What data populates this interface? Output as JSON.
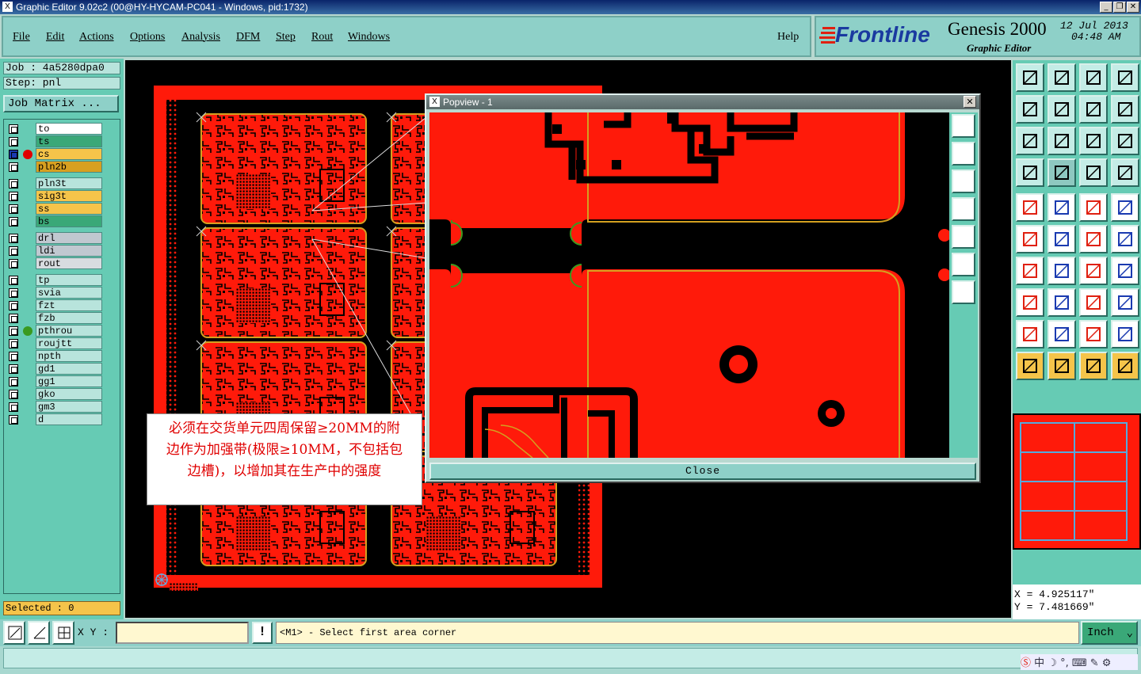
{
  "window": {
    "title": "Graphic Editor 9.02c2 (00@HY-HYCAM-PC041 - Windows, pid:1732)",
    "buttons": [
      "_",
      "❐",
      "✕"
    ]
  },
  "menu": {
    "items": [
      "File",
      "Edit",
      "Actions",
      "Options",
      "Analysis",
      "DFM",
      "Step",
      "Rout",
      "Windows"
    ],
    "help": "Help"
  },
  "brand": {
    "logo": "Frontline",
    "product": "Genesis 2000",
    "subtitle": "Graphic Editor",
    "date": "12 Jul 2013",
    "time": "04:48 AM"
  },
  "job": {
    "job_label": "Job : 4a5280dpa0",
    "step_label": "Step: pnl",
    "matrix_button": "Job Matrix ..."
  },
  "layers": [
    {
      "name": "to",
      "color": "#ffffff",
      "dot": ""
    },
    {
      "name": "ts",
      "color": "#3aa878",
      "dot": ""
    },
    {
      "name": "cs",
      "color": "#f5c44a",
      "dot": "#e00000",
      "active": true
    },
    {
      "name": "pln2b",
      "color": "#d8a020",
      "dot": ""
    },
    {
      "name": "pln3t",
      "color": "#b8e4dc",
      "dot": ""
    },
    {
      "name": "sig3t",
      "color": "#f5c44a",
      "dot": ""
    },
    {
      "name": "ss",
      "color": "#f5c44a",
      "dot": ""
    },
    {
      "name": "bs",
      "color": "#3aa878",
      "dot": ""
    },
    {
      "name": "drl",
      "color": "#c0c8d0",
      "dot": ""
    },
    {
      "name": "ldi",
      "color": "#c0c8d0",
      "dot": ""
    },
    {
      "name": "rout",
      "color": "#d8dce0",
      "dot": ""
    },
    {
      "name": "tp",
      "color": "#b8e4dc",
      "dot": ""
    },
    {
      "name": "svia",
      "color": "#b8e4dc",
      "dot": ""
    },
    {
      "name": "fzt",
      "color": "#b8e4dc",
      "dot": ""
    },
    {
      "name": "fzb",
      "color": "#b8e4dc",
      "dot": ""
    },
    {
      "name": "pthrou",
      "color": "#b8e4dc",
      "dot": "#3a9a20"
    },
    {
      "name": "roujtt",
      "color": "#b8e4dc",
      "dot": ""
    },
    {
      "name": "npth",
      "color": "#b8e4dc",
      "dot": ""
    },
    {
      "name": "gd1",
      "color": "#b8e4dc",
      "dot": ""
    },
    {
      "name": "gg1",
      "color": "#b8e4dc",
      "dot": ""
    },
    {
      "name": "gko",
      "color": "#b8e4dc",
      "dot": ""
    },
    {
      "name": "gm3",
      "color": "#b8e4dc",
      "dot": ""
    },
    {
      "name": "d",
      "color": "#b8e4dc",
      "dot": ""
    }
  ],
  "selected": "Selected : 0",
  "popview": {
    "title": "Popview - 1",
    "close_label": "Close"
  },
  "annotation": {
    "line1": "必须在交货单元四周保留≥20MM的附",
    "line2": "边作为加强带(极限≥10MM，不包括包",
    "line3": "边槽)，以增加其在生产中的强度"
  },
  "coords": {
    "x": "X  =  4.925117\"",
    "y": "Y  =  7.481669\""
  },
  "bottom": {
    "xy_label": "X Y :",
    "xy_value": "",
    "prompt": "<M1> - Select first area corner",
    "units": "Inch",
    "alert": "!"
  },
  "colors": {
    "copper": "#ff1a0a",
    "background": "#000000",
    "panel": "#66cbb4",
    "edge": "#d4a020"
  }
}
